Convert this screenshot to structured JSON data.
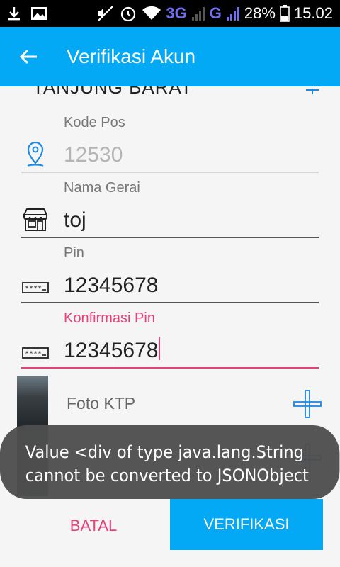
{
  "status_bar": {
    "network_3g": "3G",
    "network_g": "G",
    "battery": "28%",
    "time": "15.02"
  },
  "appbar": {
    "title": "Verifikasi Akun",
    "back_icon": "arrow-back-icon"
  },
  "form": {
    "cut_off_value": "TANJUNG BARAT",
    "kode_pos": {
      "label": "Kode Pos",
      "value": "12530",
      "icon": "location-pin-icon"
    },
    "nama_gerai": {
      "label": "Nama Gerai",
      "value": "toj",
      "icon": "store-icon"
    },
    "pin": {
      "label": "Pin",
      "value": "12345678",
      "icon": "password-icon"
    },
    "konfirmasi_pin": {
      "label": "Konfirmasi Pin",
      "value": "12345678",
      "icon": "password-icon"
    },
    "foto_ktp": {
      "label": "Foto KTP",
      "icon": "plus-icon"
    }
  },
  "toast": {
    "line1": "Value <div of type java.lang.String",
    "line2": "cannot be converted to JSONObject"
  },
  "buttons": {
    "cancel": "BATAL",
    "verify": "VERIFIKASI"
  },
  "colors": {
    "primary": "#03a9f4",
    "accent": "#e9407a",
    "toast_bg": "#4e4e4e"
  }
}
